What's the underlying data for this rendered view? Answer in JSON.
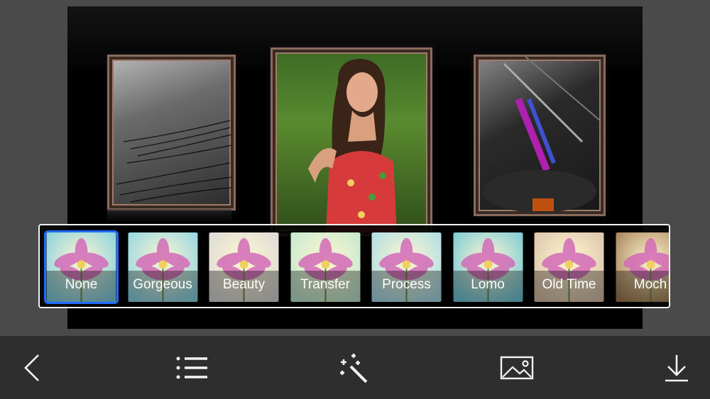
{
  "filters": [
    {
      "label": "None",
      "tint": "#7fcfe0",
      "selected": true
    },
    {
      "label": "Gorgeous",
      "tint": "#8ad4e4",
      "selected": false
    },
    {
      "label": "Beauty",
      "tint": "#d9d9d9",
      "selected": false
    },
    {
      "label": "Transfer",
      "tint": "#bfe8d0",
      "selected": false
    },
    {
      "label": "Process",
      "tint": "#a8dce8",
      "selected": false
    },
    {
      "label": "Lomo",
      "tint": "#6fc7d8",
      "selected": false
    },
    {
      "label": "Old Time",
      "tint": "#d8c0a8",
      "selected": false
    },
    {
      "label": "Moch",
      "tint": "#a07a50",
      "selected": false
    }
  ],
  "toolbar": {
    "items": [
      {
        "name": "back-button",
        "icon": "chevron-left-icon"
      },
      {
        "name": "menu-button",
        "icon": "list-icon"
      },
      {
        "name": "effects-button",
        "icon": "magic-wand-icon"
      },
      {
        "name": "gallery-button",
        "icon": "image-icon"
      },
      {
        "name": "save-button",
        "icon": "download-icon"
      }
    ]
  },
  "colors": {
    "selection": "#1e6cff",
    "toolbar_bg": "#2e2e2e",
    "page_bg": "#4a4a4a"
  }
}
